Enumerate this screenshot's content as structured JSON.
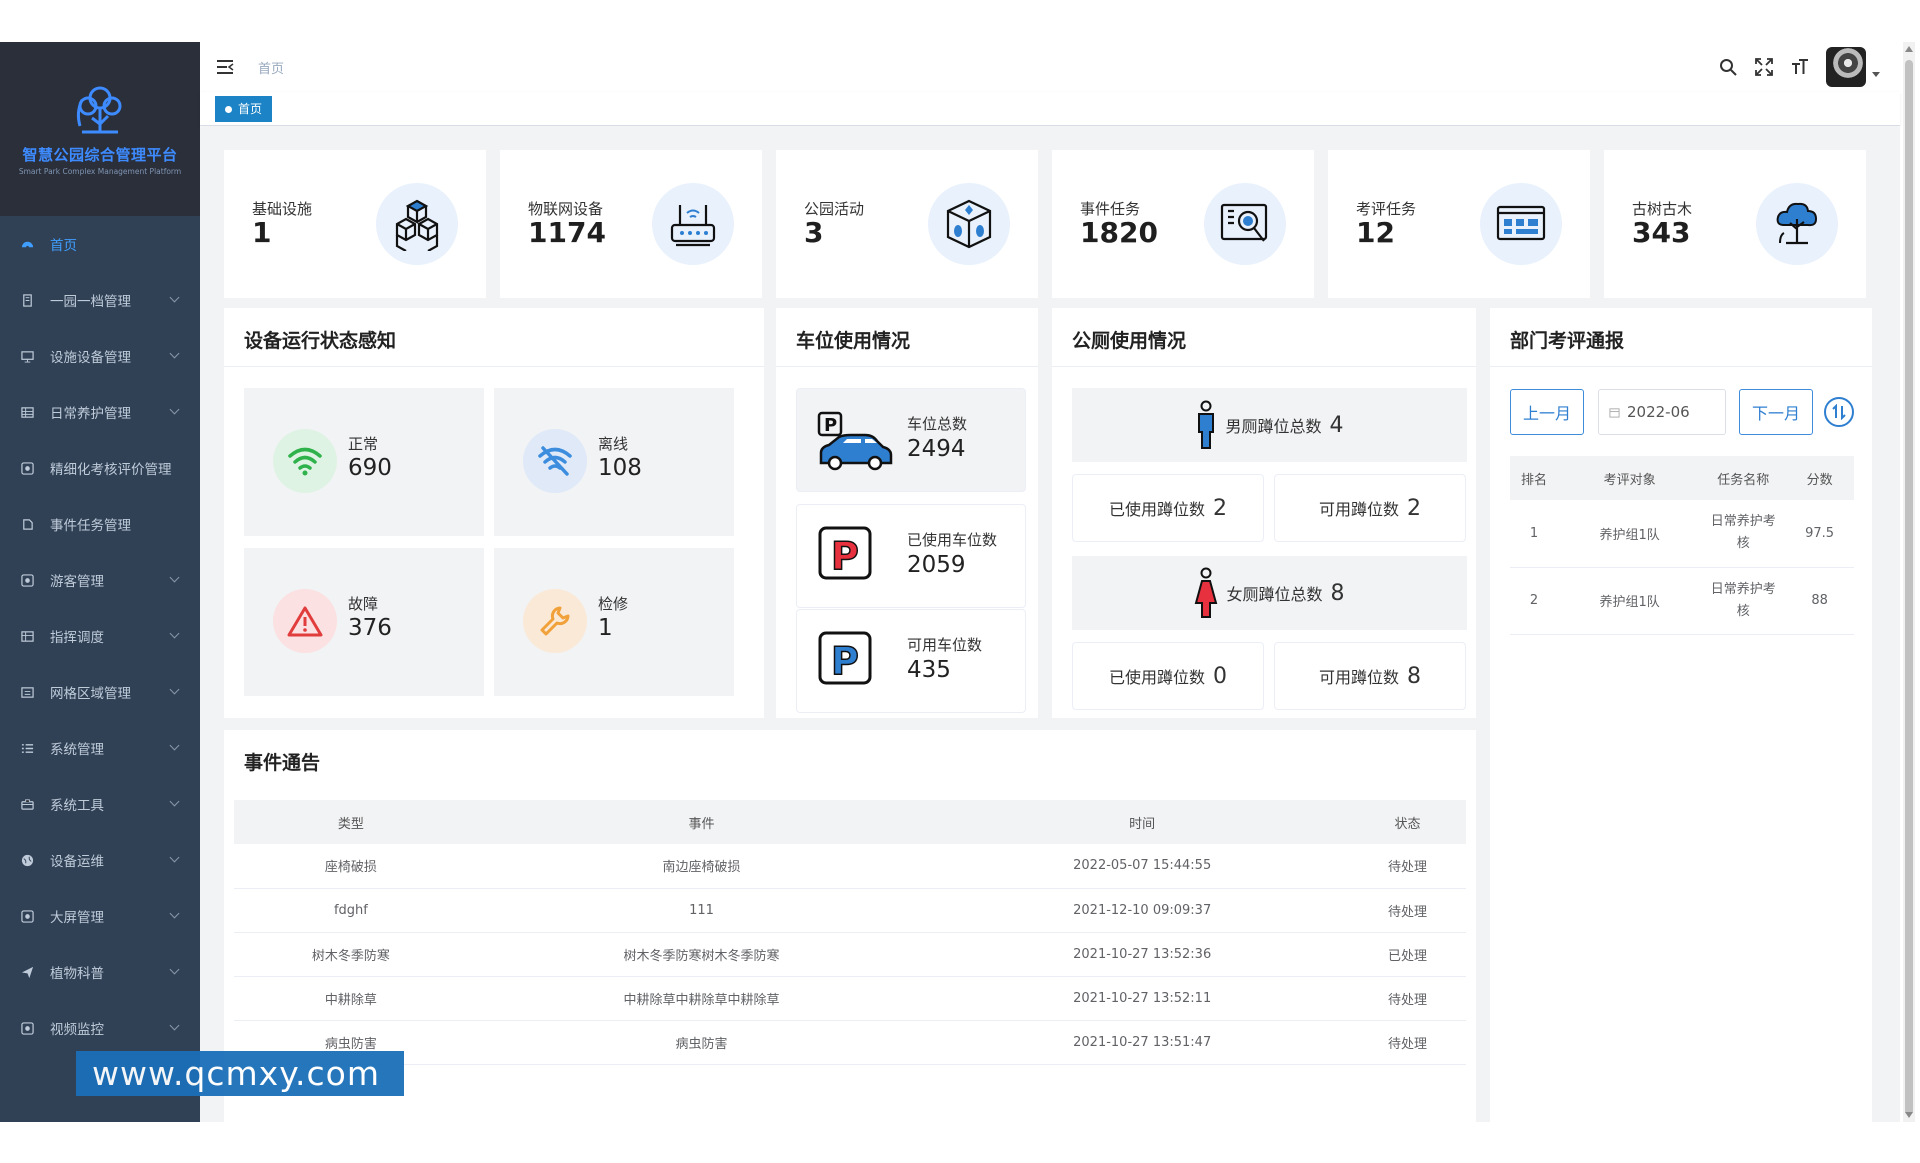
{
  "sidebar": {
    "logo_title": "智慧公园综合管理平台",
    "logo_subtitle": "Smart Park Complex Management Platform",
    "items": [
      {
        "label": "首页",
        "icon": "dashboard-icon",
        "active": true
      },
      {
        "label": "一园一档管理",
        "icon": "archive-icon"
      },
      {
        "label": "设施设备管理",
        "icon": "monitor-icon"
      },
      {
        "label": "日常养护管理",
        "icon": "table-icon"
      },
      {
        "label": "精细化考核评价管理",
        "icon": "evaluate-icon"
      },
      {
        "label": "事件任务管理",
        "icon": "task-icon"
      },
      {
        "label": "游客管理",
        "icon": "visitor-icon"
      },
      {
        "label": "指挥调度",
        "icon": "dispatch-icon"
      },
      {
        "label": "网格区域管理",
        "icon": "grid-icon"
      },
      {
        "label": "系统管理",
        "icon": "system-icon"
      },
      {
        "label": "系统工具",
        "icon": "tools-icon"
      },
      {
        "label": "设备运维",
        "icon": "globe-icon"
      },
      {
        "label": "大屏管理",
        "icon": "screen-icon"
      },
      {
        "label": "植物科普",
        "icon": "send-icon"
      },
      {
        "label": "视频监控",
        "icon": "video-icon"
      }
    ],
    "watermark": "www.qcmxy.com"
  },
  "navbar": {
    "breadcrumb": "首页",
    "tag": "首页"
  },
  "stats": [
    {
      "label": "基础设施",
      "value": "1",
      "icon": "cubes-icon"
    },
    {
      "label": "物联网设备",
      "value": "1174",
      "icon": "router-icon"
    },
    {
      "label": "公园活动",
      "value": "3",
      "icon": "activity-box-icon"
    },
    {
      "label": "事件任务",
      "value": "1820",
      "icon": "search-task-icon"
    },
    {
      "label": "考评任务",
      "value": "12",
      "icon": "evaluation-board-icon"
    },
    {
      "label": "古树古木",
      "value": "343",
      "icon": "ancient-tree-icon"
    }
  ],
  "device_status": {
    "title": "设备运行状态感知",
    "items": [
      {
        "label": "正常",
        "value": "690"
      },
      {
        "label": "离线",
        "value": "108"
      },
      {
        "label": "故障",
        "value": "376"
      },
      {
        "label": "检修",
        "value": "1"
      }
    ]
  },
  "parking": {
    "title": "车位使用情况",
    "items": [
      {
        "label": "车位总数",
        "value": "2494"
      },
      {
        "label": "已使用车位数",
        "value": "2059"
      },
      {
        "label": "可用车位数",
        "value": "435"
      }
    ]
  },
  "toilet": {
    "title": "公厕使用情况",
    "male_total_label": "男厕蹲位总数",
    "male_total": "4",
    "male_used_label": "已使用蹲位数",
    "male_used": "2",
    "male_free_label": "可用蹲位数",
    "male_free": "2",
    "female_total_label": "女厕蹲位总数",
    "female_total": "8",
    "female_used_label": "已使用蹲位数",
    "female_used": "0",
    "female_free_label": "可用蹲位数",
    "female_free": "8"
  },
  "dept": {
    "title": "部门考评通报",
    "prev_label": "上一月",
    "next_label": "下一月",
    "month": "2022-06",
    "columns": [
      "排名",
      "考评对象",
      "任务名称",
      "分数"
    ],
    "rows": [
      {
        "rank": "1",
        "target": "养护组1队",
        "task": "日常养护考核",
        "score": "97.5"
      },
      {
        "rank": "2",
        "target": "养护组1队",
        "task": "日常养护考核",
        "score": "88"
      }
    ]
  },
  "events": {
    "title": "事件通告",
    "columns": [
      "类型",
      "事件",
      "时间",
      "状态"
    ],
    "rows": [
      {
        "type": "座椅破损",
        "event": "南边座椅破损",
        "time": "2022-05-07 15:44:55",
        "status": "待处理"
      },
      {
        "type": "fdghf",
        "event": "111",
        "time": "2021-12-10 09:09:37",
        "status": "待处理"
      },
      {
        "type": "树木冬季防寒",
        "event": "树木冬季防寒树木冬季防寒",
        "time": "2021-10-27 13:52:36",
        "status": "已处理"
      },
      {
        "type": "中耕除草",
        "event": "中耕除草中耕除草中耕除草",
        "time": "2021-10-27 13:52:11",
        "status": "待处理"
      },
      {
        "type": "病虫防害",
        "event": "病虫防害",
        "time": "2021-10-27 13:51:47",
        "status": "待处理"
      }
    ]
  },
  "colors": {
    "sidebar_bg": "#304156",
    "accent": "#409eff",
    "tag_bg": "#1c84c6"
  }
}
